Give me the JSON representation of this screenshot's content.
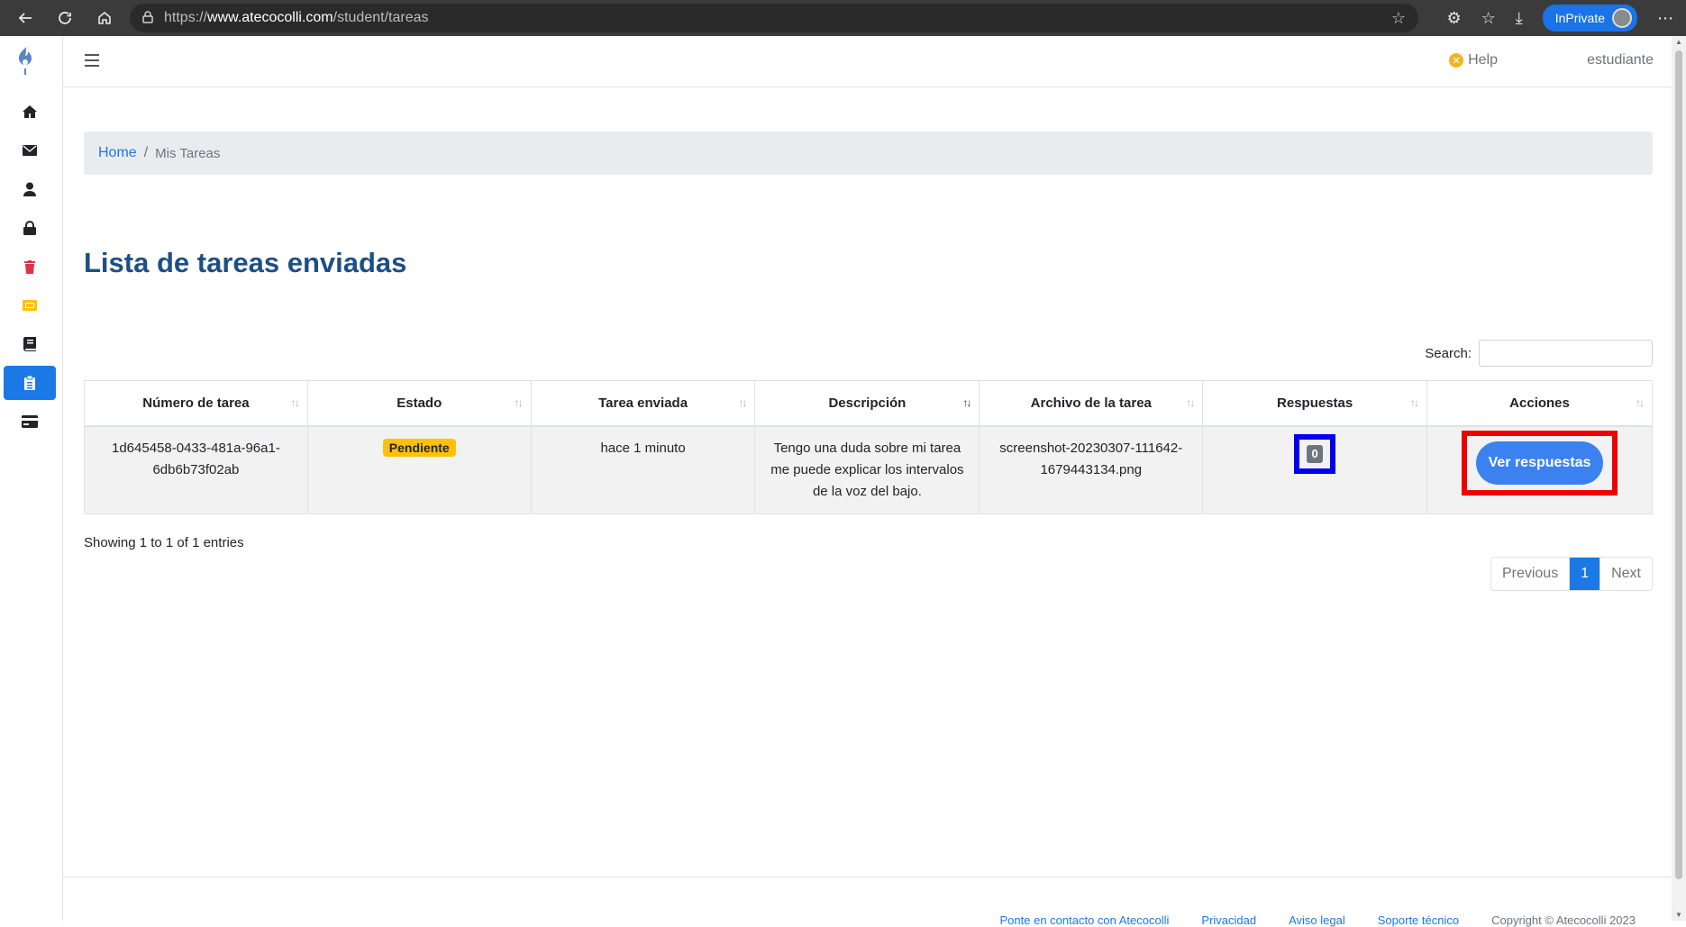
{
  "browser": {
    "url_scheme": "https://",
    "url_host": "www.atecocolli.com",
    "url_path": "/student/tareas",
    "inprivate_label": "InPrivate"
  },
  "header": {
    "help_label": "Help",
    "user_label": "estudiante"
  },
  "sidebar": {
    "items": [
      {
        "icon": "home-icon",
        "color": "#212529"
      },
      {
        "icon": "envelope-icon",
        "color": "#212529"
      },
      {
        "icon": "user-icon",
        "color": "#212529"
      },
      {
        "icon": "lock-icon",
        "color": "#212529"
      },
      {
        "icon": "trash-icon",
        "color": "#dc3545"
      },
      {
        "icon": "ticket-icon",
        "color": "#ffc107"
      },
      {
        "icon": "book-icon",
        "color": "#212529"
      },
      {
        "icon": "clipboard-icon",
        "color": "#ffffff"
      },
      {
        "icon": "credit-card-icon",
        "color": "#212529"
      }
    ]
  },
  "breadcrumb": {
    "home": "Home",
    "separator": "/",
    "current": "Mis Tareas"
  },
  "page_title": "Lista de tareas enviadas",
  "search": {
    "label": "Search:",
    "value": ""
  },
  "table": {
    "columns": [
      "Número de tarea",
      "Estado",
      "Tarea enviada",
      "Descripción",
      "Archivo de la tarea",
      "Respuestas",
      "Acciones"
    ],
    "rows": [
      {
        "id_line1": "1d645458-0433-481a-96a1-",
        "id_line2": "6db6b73f02ab",
        "status": "Pendiente",
        "sent": "hace 1 minuto",
        "desc_line1": "Tengo una duda sobre mi tarea",
        "desc_line2": "me puede explicar los intervalos",
        "desc_line3": "de la voz del bajo.",
        "file_line1": "screenshot-20230307-111642-",
        "file_line2": "1679443134.png",
        "responses": "0",
        "action": "Ver respuestas"
      }
    ]
  },
  "info": "Showing 1 to 1 of 1 entries",
  "pager": {
    "previous": "Previous",
    "current": "1",
    "next": "Next"
  },
  "footer": {
    "contact": "Ponte en contacto con Atecocolli",
    "privacy": "Privacidad",
    "legal": "Aviso legal",
    "support": "Soporte técnico",
    "copyright": "Copyright © Atecocolli 2023"
  },
  "colors": {
    "primary": "#1b79e6",
    "title": "#1d4f86",
    "warning": "#ffc107"
  }
}
